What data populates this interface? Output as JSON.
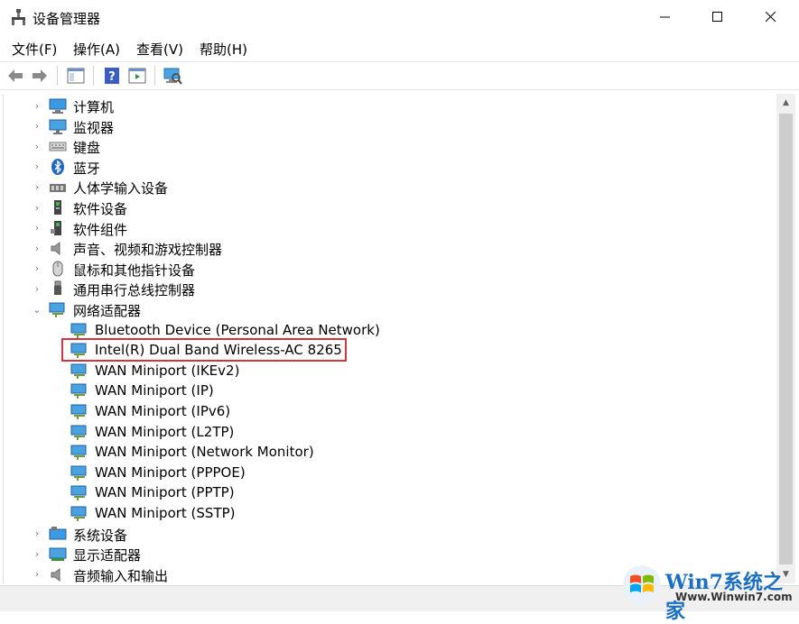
{
  "window": {
    "title": "设备管理器"
  },
  "menu": [
    "文件(F)",
    "操作(A)",
    "查看(V)",
    "帮助(H)"
  ],
  "tree": [
    {
      "label": "计算机",
      "icon": "computer-icon",
      "expanded": false
    },
    {
      "label": "监视器",
      "icon": "monitor-icon",
      "expanded": false
    },
    {
      "label": "键盘",
      "icon": "keyboard-icon",
      "expanded": false
    },
    {
      "label": "蓝牙",
      "icon": "bluetooth-icon",
      "expanded": false
    },
    {
      "label": "人体学输入设备",
      "icon": "hid-icon",
      "expanded": false
    },
    {
      "label": "软件设备",
      "icon": "software-device-icon",
      "expanded": false
    },
    {
      "label": "软件组件",
      "icon": "software-component-icon",
      "expanded": false
    },
    {
      "label": "声音、视频和游戏控制器",
      "icon": "speaker-icon",
      "expanded": false
    },
    {
      "label": "鼠标和其他指针设备",
      "icon": "mouse-icon",
      "expanded": false
    },
    {
      "label": "通用串行总线控制器",
      "icon": "usb-icon",
      "expanded": false
    },
    {
      "label": "网络适配器",
      "icon": "network-adapter-icon",
      "expanded": true
    }
  ],
  "network_children": [
    "Bluetooth Device (Personal Area Network)",
    "Intel(R) Dual Band Wireless-AC 8265",
    "WAN Miniport (IKEv2)",
    "WAN Miniport (IP)",
    "WAN Miniport (IPv6)",
    "WAN Miniport (L2TP)",
    "WAN Miniport (Network Monitor)",
    "WAN Miniport (PPPOE)",
    "WAN Miniport (PPTP)",
    "WAN Miniport (SSTP)"
  ],
  "tree_after": [
    {
      "label": "系统设备",
      "icon": "system-device-icon",
      "expanded": false
    },
    {
      "label": "显示适配器",
      "icon": "display-adapter-icon",
      "expanded": false
    },
    {
      "label": "音频输入和输出",
      "icon": "audio-io-icon",
      "expanded": false
    }
  ],
  "highlight_item": "Intel(R) Dual Band Wireless-AC 8265",
  "watermark": {
    "logo_text": "Win7系统之家",
    "url": "Www.Winwin7.com"
  },
  "colors": {
    "highlight_border": "#c8383e",
    "watermark_blue": "#1a6fc2"
  }
}
